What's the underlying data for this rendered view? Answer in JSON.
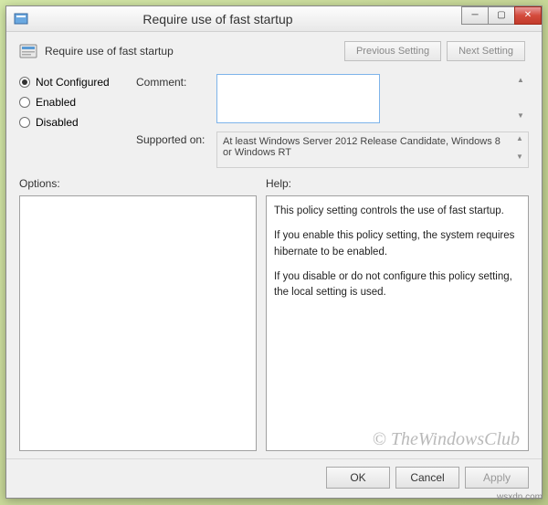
{
  "window": {
    "title": "Require use of fast startup",
    "policy_name": "Require use of fast startup"
  },
  "nav": {
    "previous": "Previous Setting",
    "next": "Next Setting"
  },
  "radios": {
    "not_configured": "Not Configured",
    "enabled": "Enabled",
    "disabled": "Disabled",
    "selected": "not_configured"
  },
  "fields": {
    "comment_label": "Comment:",
    "comment_value": "",
    "supported_label": "Supported on:",
    "supported_value": "At least Windows Server 2012 Release Candidate, Windows 8 or Windows RT"
  },
  "panels": {
    "options_label": "Options:",
    "help_label": "Help:",
    "help_lines": [
      "This policy setting controls the use of fast startup.",
      "If you enable this policy setting, the system requires hibernate to be enabled.",
      "If you disable or do not configure this policy setting, the local setting is used."
    ]
  },
  "footer": {
    "ok": "OK",
    "cancel": "Cancel",
    "apply": "Apply"
  },
  "watermark": "© TheWindowsClub",
  "url_mark": "wsxdn.com"
}
